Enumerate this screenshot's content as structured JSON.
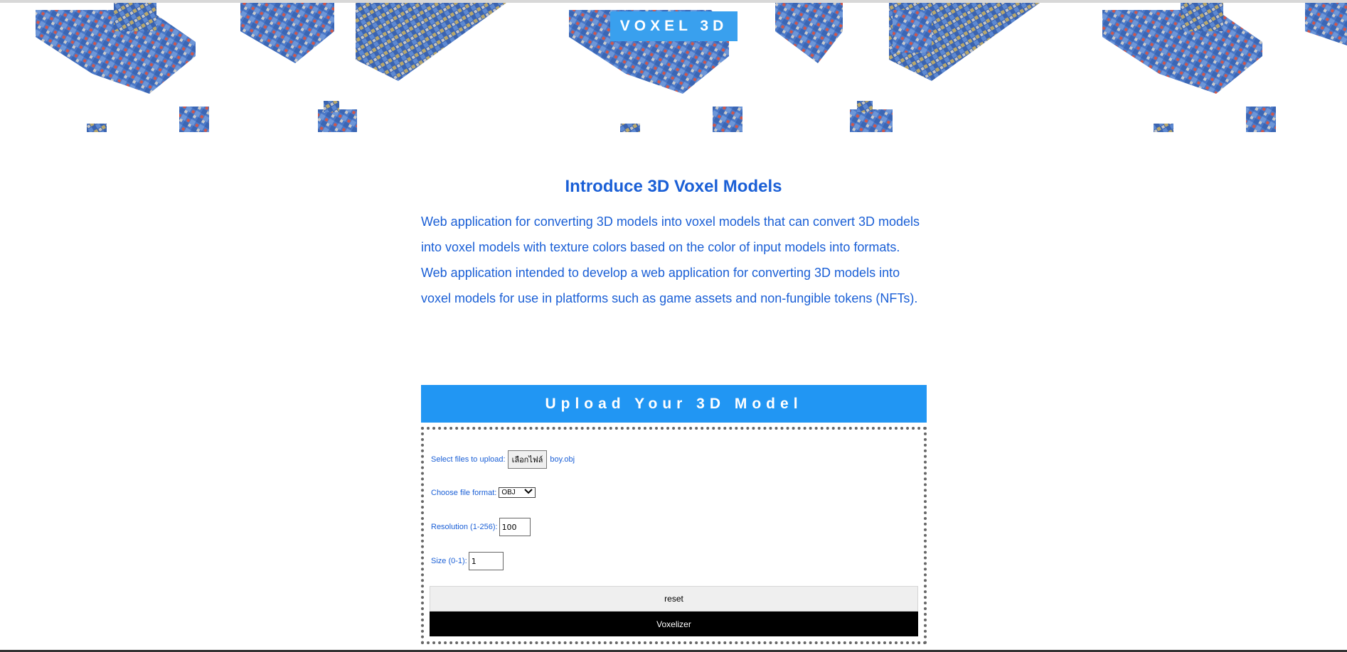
{
  "header": {
    "brand": "VOXEL 3D"
  },
  "intro": {
    "title": "Introduce 3D Voxel Models",
    "text": "Web application for converting 3D models into voxel models that can convert 3D models into voxel models with texture colors based on the color of input models into formats. Web application intended to develop a web application for converting 3D models into voxel models for use in platforms such as game assets and non-fungible tokens (NFTs)."
  },
  "upload": {
    "header": "Upload Your 3D Model",
    "file_label": "Select files to upload:",
    "file_button": "เลือกไฟล์",
    "file_name": "boy.obj",
    "format_label": "Choose file format:",
    "format_value": "OBJ",
    "resolution_label": "Resolution (1-256):",
    "resolution_value": "100",
    "size_label": "Size (0-1):",
    "size_value": "1",
    "reset_label": "reset",
    "voxel_label": "Voxelizer"
  },
  "colors": {
    "brand_bg": "#39a0ee",
    "header_bg": "#2196f3",
    "text_blue": "#1a5fd6",
    "voxel_button_bg": "#000000"
  }
}
